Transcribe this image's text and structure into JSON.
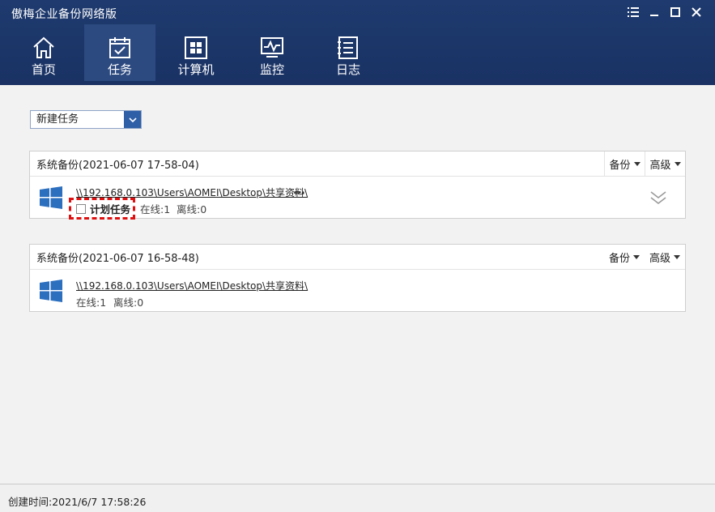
{
  "app": {
    "title": "傲梅企业备份网络版"
  },
  "nav": [
    {
      "label": "首页",
      "icon": "home-icon"
    },
    {
      "label": "任务",
      "icon": "calendar-check-icon"
    },
    {
      "label": "计算机",
      "icon": "windows-icon"
    },
    {
      "label": "监控",
      "icon": "monitor-icon"
    },
    {
      "label": "日志",
      "icon": "log-icon"
    }
  ],
  "toolbar": {
    "new_task_label": "新建任务"
  },
  "tasks": [
    {
      "title": "系统备份(2021-06-07 17-58-04)",
      "backup_label": "备份",
      "advanced_label": "高级",
      "path": "\\\\192.168.0.103\\Users\\AOMEI\\Desktop\\共享资料\\",
      "ellipsis": "...",
      "schedule_label": "计划任务",
      "online": "在线:1",
      "offline": "离线:0"
    },
    {
      "title": "系统备份(2021-06-07 16-58-48)",
      "backup_label": "备份",
      "advanced_label": "高级",
      "path": "\\\\192.168.0.103\\Users\\AOMEI\\Desktop\\共享资料\\",
      "online": "在线:1",
      "offline": "离线:0"
    }
  ],
  "footer": {
    "created_time": "创建时间:2021/6/7 17:58:26"
  },
  "colors": {
    "header": "#1e3a6e",
    "accent": "#2f5fa7",
    "highlight": "#e01010"
  }
}
